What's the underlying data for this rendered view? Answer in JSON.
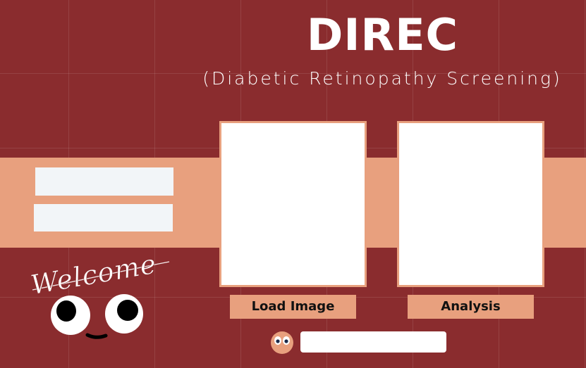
{
  "app": {
    "title": "DIREC",
    "subtitle": "(Diabetic Retinopathy Screening)"
  },
  "welcome": {
    "text": "Welcome"
  },
  "inputs": {
    "field1_value": "",
    "field2_value": ""
  },
  "buttons": {
    "load_image": "Load Image",
    "analysis": "Analysis"
  },
  "status": {
    "text": ""
  },
  "colors": {
    "background": "#8a2c2e",
    "accent": "#e8a07e",
    "panel": "#ffffff",
    "input": "#f2f5f8"
  },
  "icons": {
    "mascot": "cartoon-face-eyes-icon",
    "mini_face": "small-face-icon"
  }
}
